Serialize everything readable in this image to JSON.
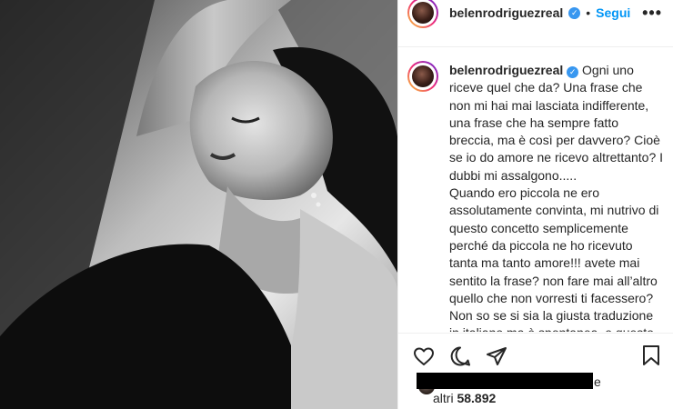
{
  "post": {
    "username": "belenrodriguezreal",
    "separator": "•",
    "follow_label": "Segui",
    "more_label": "•••",
    "verified_mark": "✓",
    "caption_username": "belenrodriguezreal",
    "caption_text": " Ogni uno riceve quel che da? Una frase che non mi hai mai lasciata indifferente, una frase che ha sempre fatto breccia, ma è così per davvero? Cioè se io do amore ne ricevo altrettanto? I dubbi mi assalgono.....\nQuando ero piccola ne ero assolutamente convinta, mi nutrivo di questo concetto semplicemente perché da piccola ne ho ricevuto tanta ma tanto amore!!! avete mai sentito la frase? non fare mai all’altro quello che non vorresti ti facessero? Non so se si sia la giusta traduzione in italiano ma è spontanea, e questo per me può bastare, potrei andare su google ma non lo faccio, perché io",
    "likes_suffix": "e",
    "likes_others_prefix": "altri ",
    "likes_others_count": "58.892"
  },
  "icons": {
    "like": "heart-icon",
    "comment": "comment-icon",
    "share": "share-icon",
    "save": "bookmark-icon"
  },
  "colors": {
    "accent": "#0095f6",
    "verified": "#3897f0",
    "text": "#262626",
    "divider": "#efefef"
  }
}
